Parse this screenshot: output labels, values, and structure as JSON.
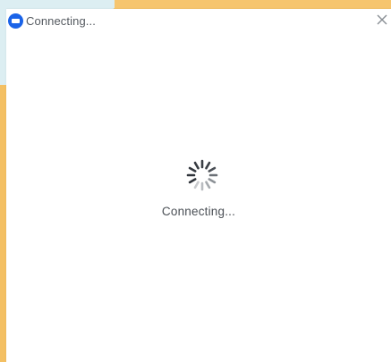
{
  "window": {
    "title": "Connecting...",
    "app_icon": "zoom-camera-icon",
    "close_icon": "close-icon"
  },
  "main": {
    "status_text": "Connecting...",
    "spinner_icon": "loading-spinner-icon"
  },
  "colors": {
    "accent": "#1a63e8",
    "background_orange": "#f6c56e",
    "background_teal": "#dceef2",
    "text": "#555a60"
  }
}
